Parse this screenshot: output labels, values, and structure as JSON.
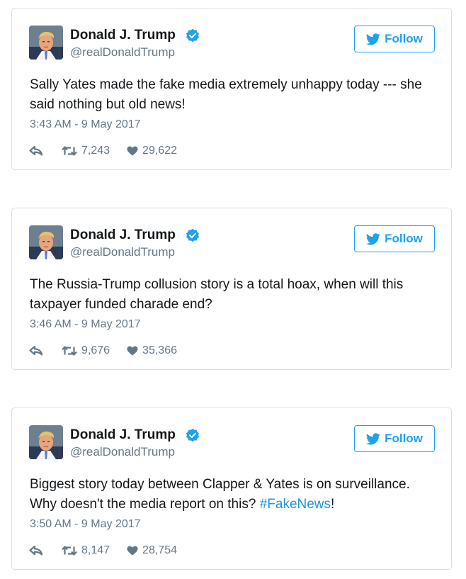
{
  "colors": {
    "accent": "#1da1f2",
    "hashtag": "#1b95e0",
    "muted": "#657786",
    "text": "#14171a",
    "border": "#d8dfe4"
  },
  "icons": {
    "verified": "verified-badge-icon",
    "follow": "twitter-bird-icon",
    "reply": "reply-icon",
    "retweet": "retweet-icon",
    "like": "heart-icon"
  },
  "tweets": [
    {
      "author": {
        "name": "Donald J. Trump",
        "handle": "@realDonaldTrump"
      },
      "follow_label": "Follow",
      "text": "Sally Yates made the fake media extremely unhappy today --- she said nothing but old news!",
      "timestamp": "3:43 AM - 9 May 2017",
      "retweets": "7,243",
      "likes": "29,622"
    },
    {
      "author": {
        "name": "Donald J. Trump",
        "handle": "@realDonaldTrump"
      },
      "follow_label": "Follow",
      "text": "The Russia-Trump collusion story is a total hoax, when will this taxpayer funded charade end?",
      "timestamp": "3:46 AM - 9 May 2017",
      "retweets": "9,676",
      "likes": "35,366"
    },
    {
      "author": {
        "name": "Donald J. Trump",
        "handle": "@realDonaldTrump"
      },
      "follow_label": "Follow",
      "text": "Biggest story today between Clapper & Yates is on surveillance. Why doesn't the media report on this?",
      "hashtag": "#FakeNews",
      "text_end": "!",
      "timestamp": "3:50 AM - 9 May 2017",
      "retweets": "8,147",
      "likes": "28,754"
    }
  ]
}
